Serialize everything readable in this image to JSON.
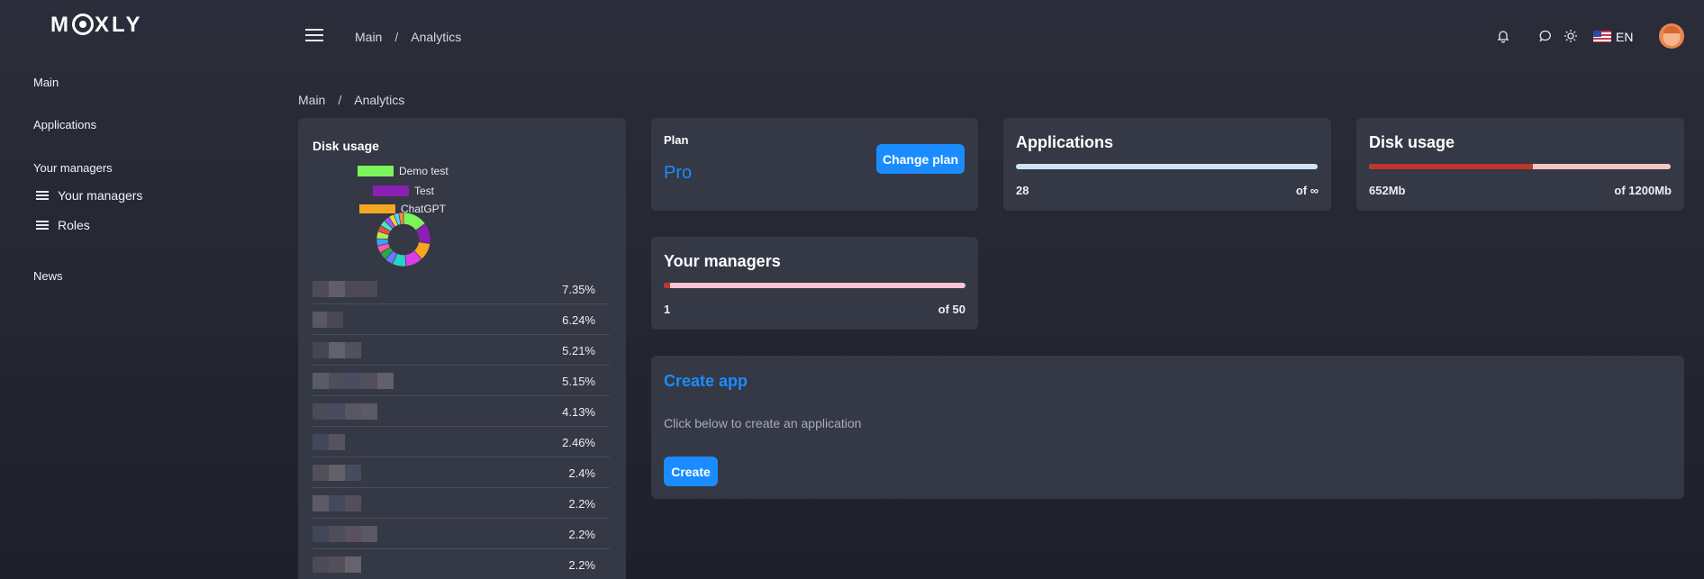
{
  "brand": {
    "logo_text_pre": "M",
    "logo_text_post": "XLY"
  },
  "sidebar": {
    "items": [
      {
        "label": "Main"
      },
      {
        "label": "Applications"
      },
      {
        "label": "Your managers"
      },
      {
        "label": "News"
      }
    ],
    "sub_items": [
      {
        "label": "Your managers",
        "icon": "list-icon"
      },
      {
        "label": "Roles",
        "icon": "list-icon"
      }
    ]
  },
  "header": {
    "breadcrumb": [
      "Main",
      "Analytics"
    ],
    "separator": "/",
    "icons": [
      "bell-icon",
      "chat-icon",
      "sun-icon"
    ],
    "language": "EN"
  },
  "page": {
    "breadcrumb": [
      "Main",
      "Analytics"
    ],
    "separator": "/"
  },
  "disk_usage_chart": {
    "title": "Disk usage",
    "legend": [
      {
        "label": "Demo test",
        "color": "#7df55a"
      },
      {
        "label": "Test",
        "color": "#8a1fb3"
      },
      {
        "label": "ChatGPT",
        "color": "#f5a623"
      }
    ],
    "rows": [
      {
        "pct": "7.35%"
      },
      {
        "pct": "6.24%"
      },
      {
        "pct": "5.21%"
      },
      {
        "pct": "5.15%"
      },
      {
        "pct": "4.13%"
      },
      {
        "pct": "2.46%"
      },
      {
        "pct": "2.4%"
      },
      {
        "pct": "2.2%"
      },
      {
        "pct": "2.2%"
      },
      {
        "pct": "2.2%"
      }
    ]
  },
  "chart_data": {
    "type": "pie",
    "title": "Disk usage",
    "categories": [
      "Demo test",
      "Test",
      "ChatGPT"
    ],
    "values": [
      7.35,
      6.24,
      5.21,
      5.15,
      4.13,
      2.46,
      2.4,
      2.2,
      2.2,
      2.2
    ],
    "colors": [
      "#7df55a",
      "#8a1fb3",
      "#f5a623",
      "#d93ee8",
      "#2ad1c8",
      "#6a79ff",
      "#29a84a",
      "#ff5aa8",
      "#3ea0ff",
      "#b6e84a",
      "#e84a4a",
      "#4ae8b5",
      "#9a5aff",
      "#ffd13e",
      "#5ad1ff",
      "#ff8a3e"
    ],
    "legend": "top"
  },
  "plan": {
    "label": "Plan",
    "value": "Pro",
    "button": "Change plan"
  },
  "applications": {
    "title": "Applications",
    "count": "28",
    "limit": "of ∞",
    "progress": 1.0
  },
  "disk_usage": {
    "title": "Disk usage",
    "used": "652Mb",
    "limit": "of 1200Mb",
    "progress": 0.543
  },
  "managers": {
    "title": "Your managers",
    "count": "1",
    "limit": "of 50",
    "progress": 0.02
  },
  "create_app": {
    "title": "Create app",
    "description": "Click below to create an application",
    "button": "Create"
  },
  "colors": {
    "accent": "#1a8cff",
    "card_bg": "#353845",
    "disk_bar_used": "#c0362c",
    "disk_bar_track": "#f7c5c9",
    "apps_bar": "#cfe4f7",
    "managers_bar": "#f7c5d6"
  }
}
